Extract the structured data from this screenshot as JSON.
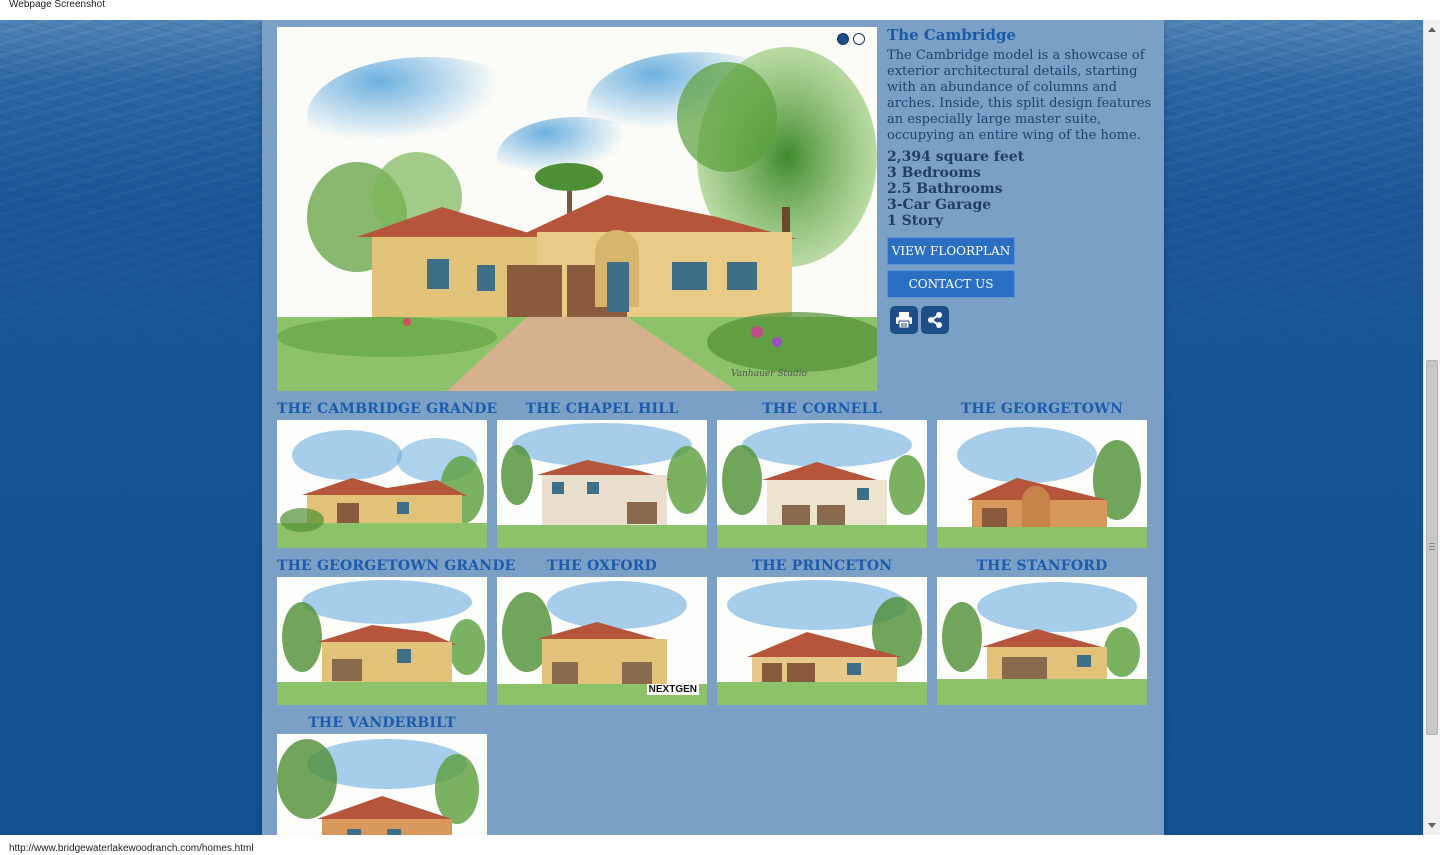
{
  "window": {
    "title": "Webpage Screenshot"
  },
  "status_bar": {
    "url": "http://www.bridgewaterlakewoodranch.com/homes.html"
  },
  "hero": {
    "slides_total": 2,
    "active_slide": 1,
    "artist_signature": "Vanhauer Studio"
  },
  "model": {
    "name": "The Cambridge",
    "description": "The Cambridge model is a showcase of exterior architectural details, starting with an abundance of columns and arches. Inside, this split design features an especially large master suite, occupying an entire wing of the home.",
    "specs": [
      "2,394 square feet",
      "3 Bedrooms",
      "2.5 Bathrooms",
      "3-Car Garage",
      "1 Story"
    ],
    "buttons": {
      "floorplan": "VIEW FLOORPLAN",
      "contact": "CONTACT US"
    },
    "icons": [
      "print-icon",
      "share-icon"
    ]
  },
  "other_models": [
    {
      "name": "THE CAMBRIDGE GRANDE"
    },
    {
      "name": "THE CHAPEL HILL"
    },
    {
      "name": "THE CORNELL"
    },
    {
      "name": "THE GEORGETOWN"
    },
    {
      "name": "THE GEORGETOWN GRANDE"
    },
    {
      "name": "THE OXFORD",
      "badge": "NEXTGEN"
    },
    {
      "name": "THE PRINCETON"
    },
    {
      "name": "THE STANFORD"
    },
    {
      "name": "THE VANDERBILT"
    }
  ],
  "colors": {
    "panel": "#7aa0c6",
    "title_blue": "#1a5aa6",
    "button_blue": "#2b6fc3",
    "icon_navy": "#1c4f87",
    "ocean": "#165393"
  }
}
